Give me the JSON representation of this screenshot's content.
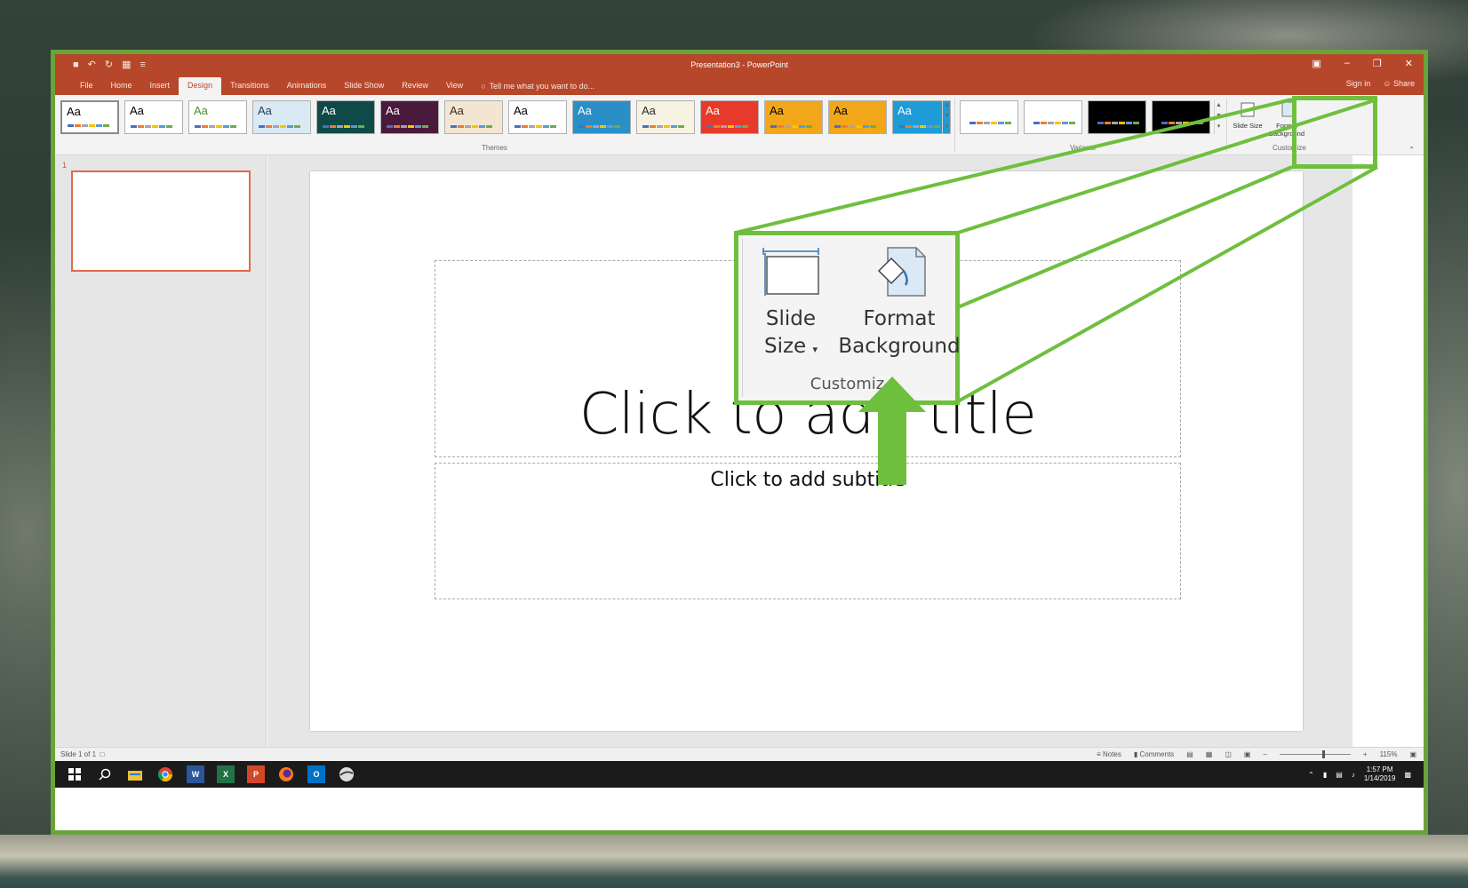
{
  "window": {
    "title": "Presentation3 - PowerPoint"
  },
  "tabs": [
    "File",
    "Home",
    "Insert",
    "Design",
    "Transitions",
    "Animations",
    "Slide Show",
    "Review",
    "View"
  ],
  "active_tab": "Design",
  "tell_me": "Tell me what you want to do...",
  "top_right": {
    "sign_in": "Sign in",
    "share": "Share"
  },
  "ribbon": {
    "themes_label": "Themes",
    "variants_label": "Variants",
    "customize_label": "Customize",
    "theme_tiles": [
      {
        "text": "Aa",
        "bg": "#ffffff",
        "fg": "#000000"
      },
      {
        "text": "Aa",
        "bg": "#ffffff",
        "fg": "#000000"
      },
      {
        "text": "Aa",
        "bg": "#ffffff",
        "fg": "#4a8c2a"
      },
      {
        "text": "Aa",
        "bg": "#d9eaf4",
        "fg": "#1f3c5a"
      },
      {
        "text": "Aa",
        "bg": "#0f4a48",
        "fg": "#ffffff"
      },
      {
        "text": "Aa",
        "bg": "#4a1a3c",
        "fg": "#ffffff"
      },
      {
        "text": "Aa",
        "bg": "#f2e6d2",
        "fg": "#3a2a1a"
      },
      {
        "text": "Aa",
        "bg": "#ffffff",
        "fg": "#000000"
      },
      {
        "text": "Aa",
        "bg": "#2a8fc6",
        "fg": "#ffffff"
      },
      {
        "text": "Aa",
        "bg": "#f7f3e3",
        "fg": "#2a2a2a"
      },
      {
        "text": "Aa",
        "bg": "#e83a2a",
        "fg": "#ffffff"
      },
      {
        "text": "Aa",
        "bg": "#f2a71b",
        "fg": "#000000"
      },
      {
        "text": "Aa",
        "bg": "#f2a71b",
        "fg": "#000000"
      },
      {
        "text": "Aa",
        "bg": "#1f9bd6",
        "fg": "#ffffff"
      }
    ],
    "variant_tiles": [
      {
        "bg": "#ffffff"
      },
      {
        "bg": "#ffffff"
      },
      {
        "bg": "#000000"
      },
      {
        "bg": "#000000"
      }
    ],
    "slide_size_small": "Slide Size",
    "format_background_small": "Format Background"
  },
  "thumbnail": {
    "number": "1"
  },
  "slide": {
    "title_placeholder": "Click to add title",
    "subtitle_placeholder": "Click to add subtitle"
  },
  "status": {
    "slide_of": "Slide 1 of 1",
    "notes": "Notes",
    "comments": "Comments",
    "zoom": "115%"
  },
  "taskbar": {
    "time": "1:57 PM",
    "date": "1/14/2019"
  },
  "callout": {
    "slide_line1": "Slide",
    "slide_line2": "Size",
    "format_line1": "Format",
    "format_line2": "Background",
    "group": "Customiz"
  },
  "colors": {
    "accent": "#b7472a",
    "highlight": "#6fbf3f"
  }
}
